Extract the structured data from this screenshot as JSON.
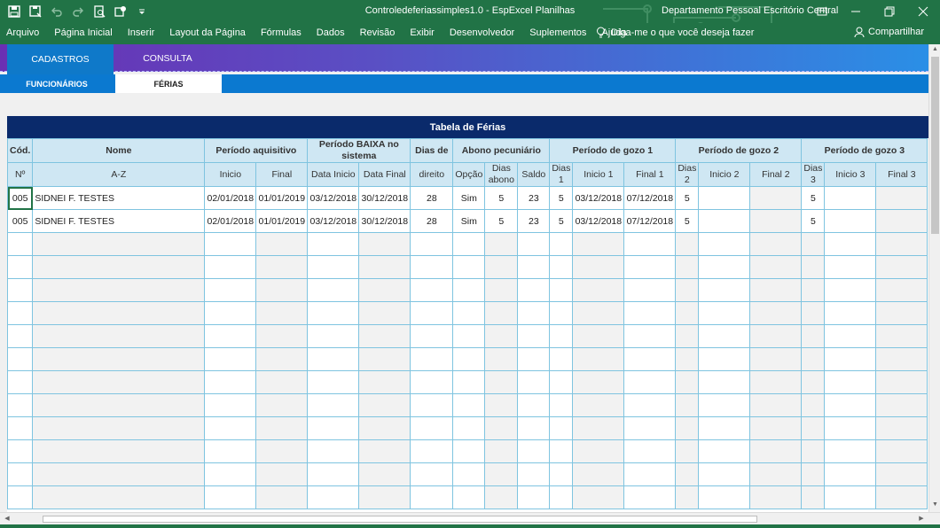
{
  "window": {
    "title": "Controledeferiassimples1.0  -  EspExcel Planilhas",
    "account": "Departamento Pessoal Escritório Central"
  },
  "menu": {
    "tabs": [
      "Arquivo",
      "Página Inicial",
      "Inserir",
      "Layout da Página",
      "Fórmulas",
      "Dados",
      "Revisão",
      "Exibir",
      "Desenvolvedor",
      "Suplementos",
      "Ajuda"
    ],
    "tell_me": "Diga-me o que você deseja fazer",
    "share": "Compartilhar"
  },
  "nav": {
    "cadastros": "CADASTROS",
    "consulta": "CONSULTA",
    "funcionarios": "FUNCIONÁRIOS",
    "ferias": "FÉRIAS"
  },
  "table": {
    "title": "Tabela de Férias",
    "groups": {
      "cod": "Cód.",
      "nome": "Nome",
      "aquisitivo": "Período aquisitivo",
      "baixa": "Período BAIXA no sistema",
      "dias_de": "Dias de",
      "abono": "Abono pecuniário",
      "gozo1": "Período de gozo 1",
      "gozo2": "Período de gozo 2",
      "gozo3": "Período de gozo 3"
    },
    "subheaders": {
      "n": "Nº",
      "az": "A-Z",
      "inicio": "Inicio",
      "final": "Final",
      "data_inicio": "Data Inicio",
      "data_final": "Data Final",
      "direito": "direito",
      "opcao": "Opção",
      "dias_abono": "Dias abono",
      "saldo": "Saldo",
      "dias1": "Dias 1",
      "inicio1": "Inicio 1",
      "final1": "Final 1",
      "dias2": "Dias 2",
      "inicio2": "Inicio 2",
      "final2": "Final 2",
      "dias3": "Dias 3",
      "inicio3": "Inicio 3",
      "final3": "Final 3"
    },
    "rows": [
      {
        "cod": "005",
        "nome": "SIDNEI F. TESTES",
        "inicio": "02/01/2018",
        "final": "01/01/2019",
        "data_inicio": "03/12/2018",
        "data_final": "30/12/2018",
        "dias_direito": "28",
        "opcao": "Sim",
        "dias_abono": "5",
        "saldo": "23",
        "dias1": "5",
        "inicio1": "03/12/2018",
        "final1": "07/12/2018",
        "dias2": "5",
        "inicio2": "",
        "final2": "",
        "dias3": "5",
        "inicio3": "",
        "final3": ""
      },
      {
        "cod": "005",
        "nome": "SIDNEI F. TESTES",
        "inicio": "02/01/2018",
        "final": "01/01/2019",
        "data_inicio": "03/12/2018",
        "data_final": "30/12/2018",
        "dias_direito": "28",
        "opcao": "Sim",
        "dias_abono": "5",
        "saldo": "23",
        "dias1": "5",
        "inicio1": "03/12/2018",
        "final1": "07/12/2018",
        "dias2": "5",
        "inicio2": "",
        "final2": "",
        "dias3": "5",
        "inicio3": "",
        "final3": ""
      }
    ],
    "empty_rows": 12
  },
  "colors": {
    "excel_green": "#217346",
    "table_title_bg": "#0a2a6b",
    "header_bg": "#cfe7f3",
    "grid_border": "#7fc4e0",
    "nav_blue": "#0b79d0"
  }
}
